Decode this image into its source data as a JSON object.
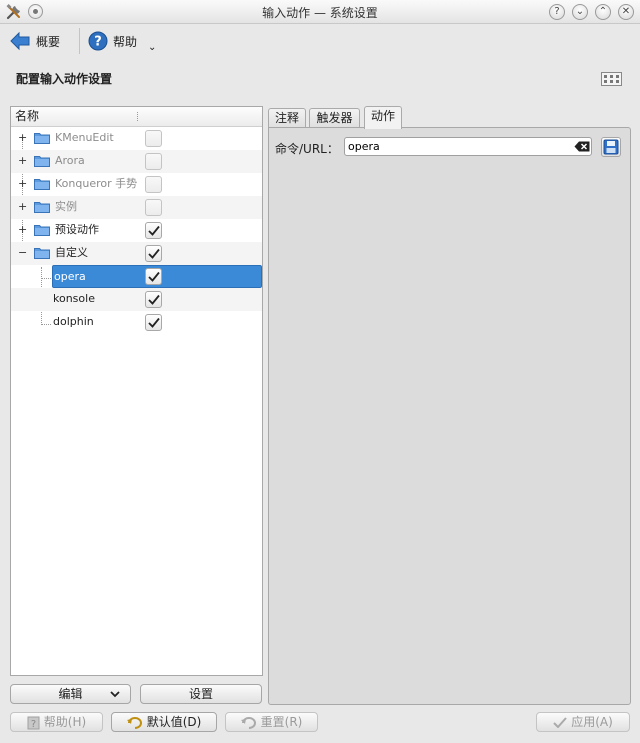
{
  "window": {
    "title": "输入动作 — 系统设置"
  },
  "toolbar": {
    "overview_label": "概要",
    "help_label": "帮助"
  },
  "page": {
    "heading": "配置输入动作设置"
  },
  "tree": {
    "column_header": "名称",
    "items": [
      {
        "label": "KMenuEdit",
        "checked": false,
        "enabled": false
      },
      {
        "label": "Arora",
        "checked": false,
        "enabled": false
      },
      {
        "label": "Konqueror 手势",
        "checked": false,
        "enabled": false
      },
      {
        "label": "实例",
        "checked": false,
        "enabled": false
      },
      {
        "label": "预设动作",
        "checked": true,
        "enabled": true
      },
      {
        "label": "自定义",
        "checked": true,
        "enabled": true,
        "children": [
          {
            "label": "opera",
            "checked": true,
            "selected": true
          },
          {
            "label": "konsole",
            "checked": true
          },
          {
            "label": "dolphin",
            "checked": true
          }
        ]
      }
    ]
  },
  "tree_buttons": {
    "edit_label": "编辑",
    "settings_label": "设置"
  },
  "tabs": [
    {
      "label": "注释",
      "active": false
    },
    {
      "label": "触发器",
      "active": false
    },
    {
      "label": "动作",
      "active": true
    }
  ],
  "action": {
    "command_label": "命令/URL：",
    "command_value": "opera"
  },
  "footer": {
    "help_label": "帮助(H)",
    "defaults_label": "默认值(D)",
    "reset_label": "重置(R)",
    "apply_label": "应用(A)"
  },
  "colors": {
    "selection": "#3b8ad8",
    "folder": "#5c9be0",
    "background": "#e8e8e8"
  }
}
